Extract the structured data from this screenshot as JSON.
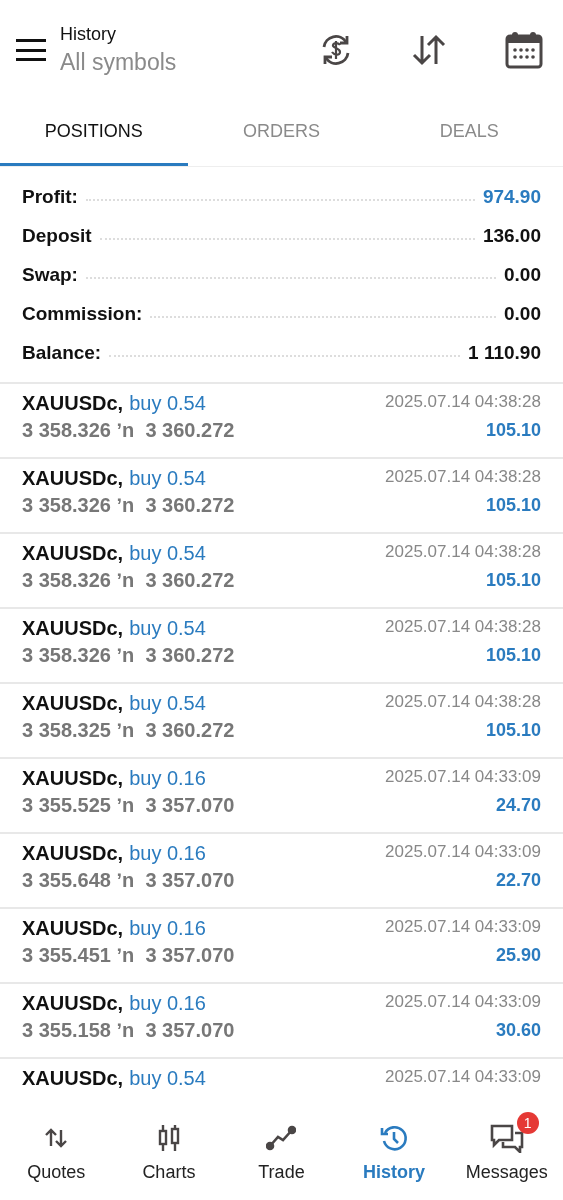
{
  "header": {
    "title": "History",
    "subtitle": "All symbols"
  },
  "tabs": [
    {
      "label": "POSITIONS",
      "selected": true
    },
    {
      "label": "ORDERS",
      "selected": false
    },
    {
      "label": "DEALS",
      "selected": false
    }
  ],
  "summary": [
    {
      "label": "Profit:",
      "value": "974.90",
      "highlight": true
    },
    {
      "label": "Deposit",
      "value": "136.00",
      "highlight": false
    },
    {
      "label": "Swap:",
      "value": "0.00",
      "highlight": false
    },
    {
      "label": "Commission:",
      "value": "0.00",
      "highlight": false
    },
    {
      "label": "Balance:",
      "value": "1 110.90",
      "highlight": false
    }
  ],
  "positions": [
    {
      "symbol": "XAUUSDc,",
      "trade": "buy 0.54",
      "time": "2025.07.14 04:38:28",
      "prices": "3 358.326 ʼn  3 360.272",
      "profit": "105.10"
    },
    {
      "symbol": "XAUUSDc,",
      "trade": "buy 0.54",
      "time": "2025.07.14 04:38:28",
      "prices": "3 358.326 ʼn  3 360.272",
      "profit": "105.10"
    },
    {
      "symbol": "XAUUSDc,",
      "trade": "buy 0.54",
      "time": "2025.07.14 04:38:28",
      "prices": "3 358.326 ʼn  3 360.272",
      "profit": "105.10"
    },
    {
      "symbol": "XAUUSDc,",
      "trade": "buy 0.54",
      "time": "2025.07.14 04:38:28",
      "prices": "3 358.326 ʼn  3 360.272",
      "profit": "105.10"
    },
    {
      "symbol": "XAUUSDc,",
      "trade": "buy 0.54",
      "time": "2025.07.14 04:38:28",
      "prices": "3 358.325 ʼn  3 360.272",
      "profit": "105.10"
    },
    {
      "symbol": "XAUUSDc,",
      "trade": "buy 0.16",
      "time": "2025.07.14 04:33:09",
      "prices": "3 355.525 ʼn  3 357.070",
      "profit": "24.70"
    },
    {
      "symbol": "XAUUSDc,",
      "trade": "buy 0.16",
      "time": "2025.07.14 04:33:09",
      "prices": "3 355.648 ʼn  3 357.070",
      "profit": "22.70"
    },
    {
      "symbol": "XAUUSDc,",
      "trade": "buy 0.16",
      "time": "2025.07.14 04:33:09",
      "prices": "3 355.451 ʼn  3 357.070",
      "profit": "25.90"
    },
    {
      "symbol": "XAUUSDc,",
      "trade": "buy 0.16",
      "time": "2025.07.14 04:33:09",
      "prices": "3 355.158 ʼn  3 357.070",
      "profit": "30.60"
    },
    {
      "symbol": "XAUUSDc,",
      "trade": "buy 0.54",
      "time": "2025.07.14 04:33:09"
    }
  ],
  "nav": [
    {
      "kind": "quotes",
      "label": "Quotes",
      "selected": false
    },
    {
      "kind": "charts",
      "label": "Charts",
      "selected": false
    },
    {
      "kind": "trade",
      "label": "Trade",
      "selected": false
    },
    {
      "kind": "history",
      "label": "History",
      "selected": true
    },
    {
      "kind": "messages",
      "label": "Messages",
      "selected": false,
      "badge": "1"
    }
  ]
}
